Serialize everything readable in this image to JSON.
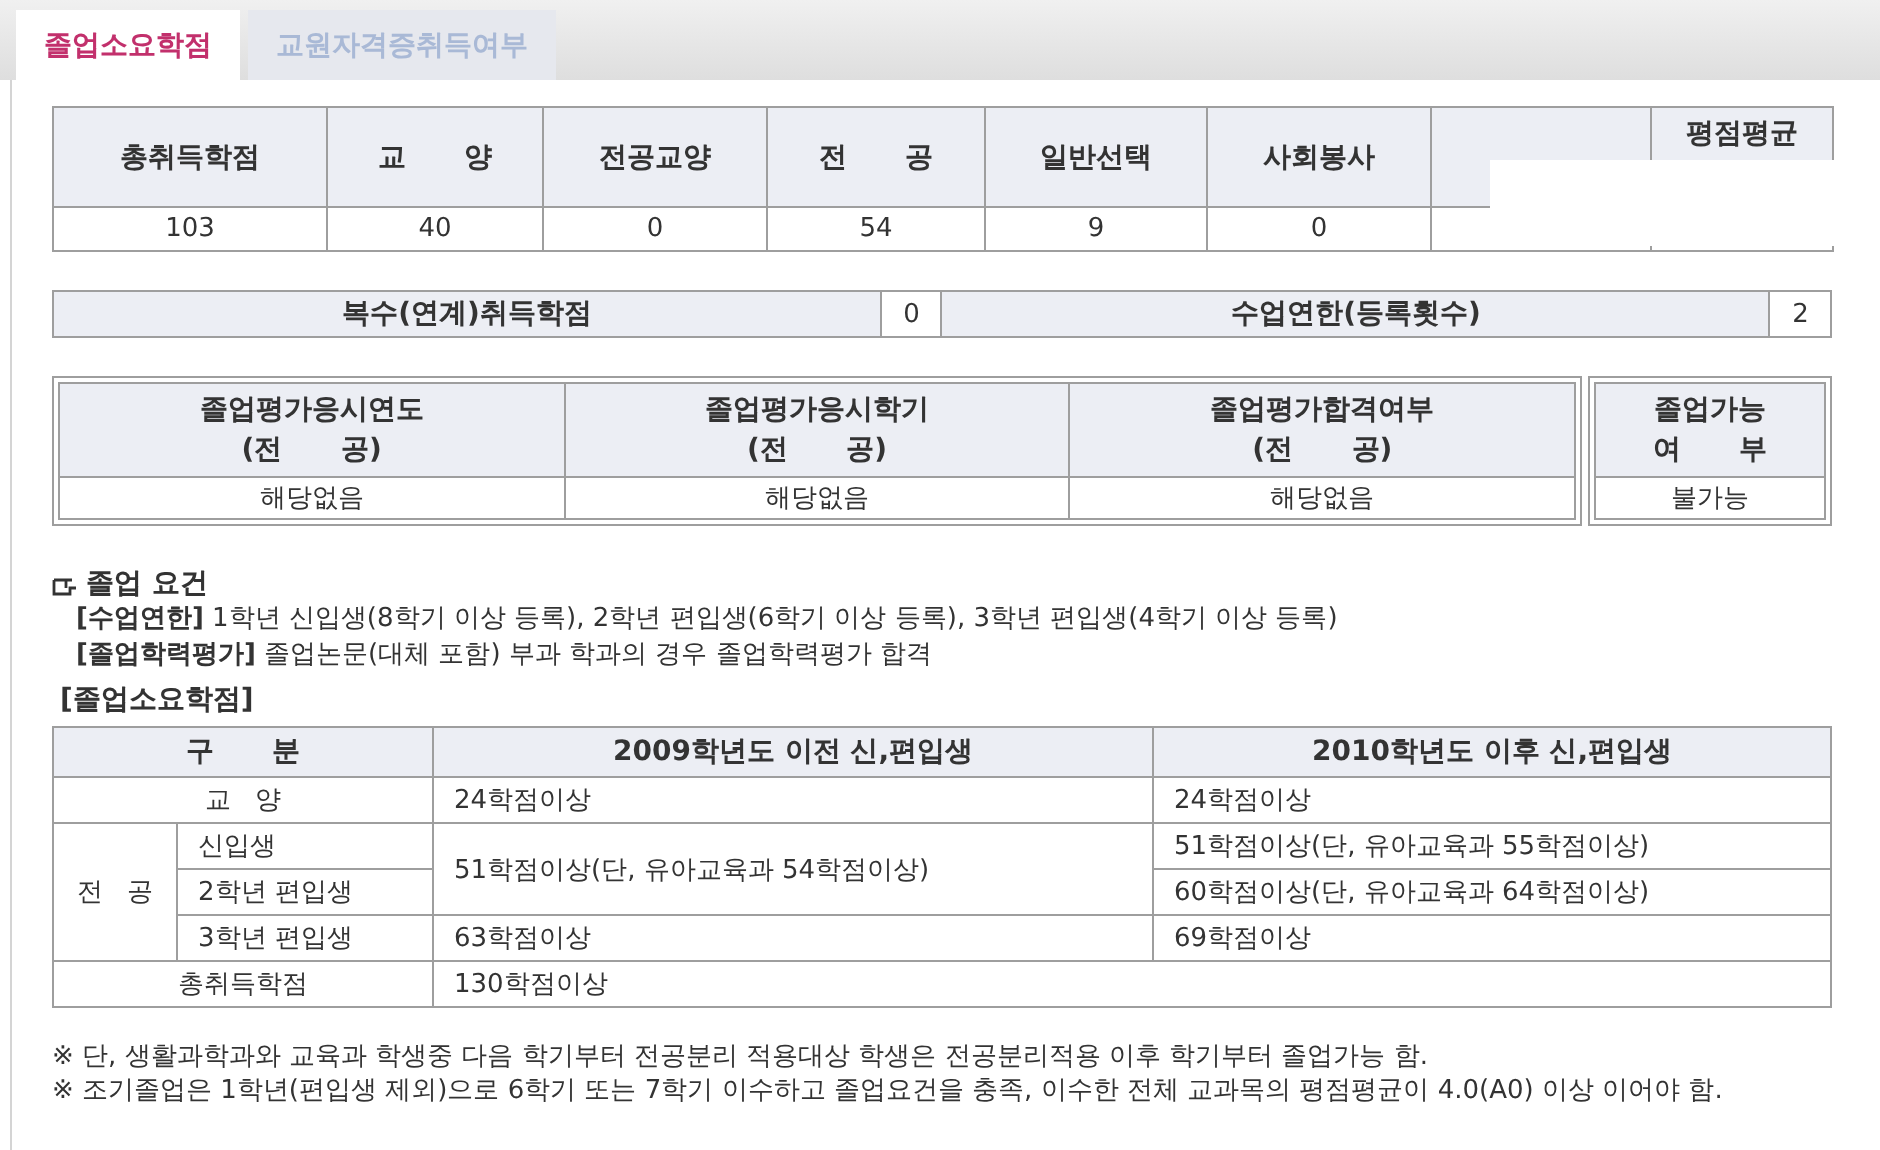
{
  "tabs": [
    {
      "label": "졸업소요학점",
      "selected": true
    },
    {
      "label": "교원자격증취득여부",
      "selected": false
    }
  ],
  "credits": {
    "columns": [
      {
        "header": "총취득학점",
        "value": "103"
      },
      {
        "header": "교      양",
        "value": "40"
      },
      {
        "header": "전공교양",
        "value": "0"
      },
      {
        "header": "전      공",
        "value": "54"
      },
      {
        "header": "일반선택",
        "value": "9"
      },
      {
        "header": "사회봉사",
        "value": "0"
      },
      {},
      {
        "header": "평점평균"
      }
    ]
  },
  "enrollment": [
    {
      "label": "복수(연계)취득학점",
      "value": "0"
    },
    {
      "label": "수업연한(등록횟수)",
      "value": "2"
    }
  ],
  "evaluation": {
    "columns": [
      {
        "header": [
          "졸업평가응시연도",
          "(전      공)"
        ],
        "value": "해당없음"
      },
      {
        "header": [
          "졸업평가응시학기",
          "(전      공)"
        ],
        "value": "해당없음"
      },
      {
        "header": [
          "졸업평가합격여부",
          "(전      공)"
        ],
        "value": "해당없음"
      }
    ],
    "result": {
      "header": [
        "졸업가능",
        "여      부"
      ],
      "value": "불가능"
    }
  },
  "requirements": {
    "title": "졸업 요건",
    "items": [
      "**[수업연한]** 1학년 신입생(8학기 이상 등록), 2학년 편입생(6학기 이상 등록), 3학년 편입생(4학기 이상 등록)",
      "**[졸업학력평가]** 졸업논문(대체 포함) 부과 학과의 경우 졸업학력평가 합격"
    ]
  },
  "credit_table": {
    "title": "[졸업소요학점]",
    "headers": [
      "구      분",
      "2009학년도 이전 신,편입생",
      "2010학년도 이후 신,편입생"
    ],
    "rows": [
      {
        "label": "교   양",
        "cells": [
          "24학점이상",
          "24학점이상"
        ]
      },
      {
        "label": "전   공",
        "children": [
          {
            "label": "신입생",
            "cells": [
              "51학점이상(단, 유아교육과 54학점이상)",
              "51학점이상(단, 유아교육과 55학점이상)"
            ]
          },
          {
            "label": "2학년 편입생",
            "cells": [
              "60학점이상(단, 유아교육과 64학점이상)"
            ]
          },
          {
            "label": "3학년 편입생",
            "cells": [
              "63학점이상",
              "69학점이상"
            ]
          }
        ]
      },
      {
        "label": "총취득학점",
        "cells": [
          "130학점이상"
        ]
      }
    ]
  },
  "notes": [
    "※ 단, 생활과학과와 교육과 학생중 다음 학기부터 전공분리 적용대상 학생은 전공분리적용 이후 학기부터 졸업가능 함.",
    "※ 조기졸업은 1학년(편입생 제외)으로 6학기 또는 7학기 이수하고 졸업요건을 충족, 이수한 전체 교과목의 평점평균이 4.0(A0) 이상 이어야 함."
  ]
}
